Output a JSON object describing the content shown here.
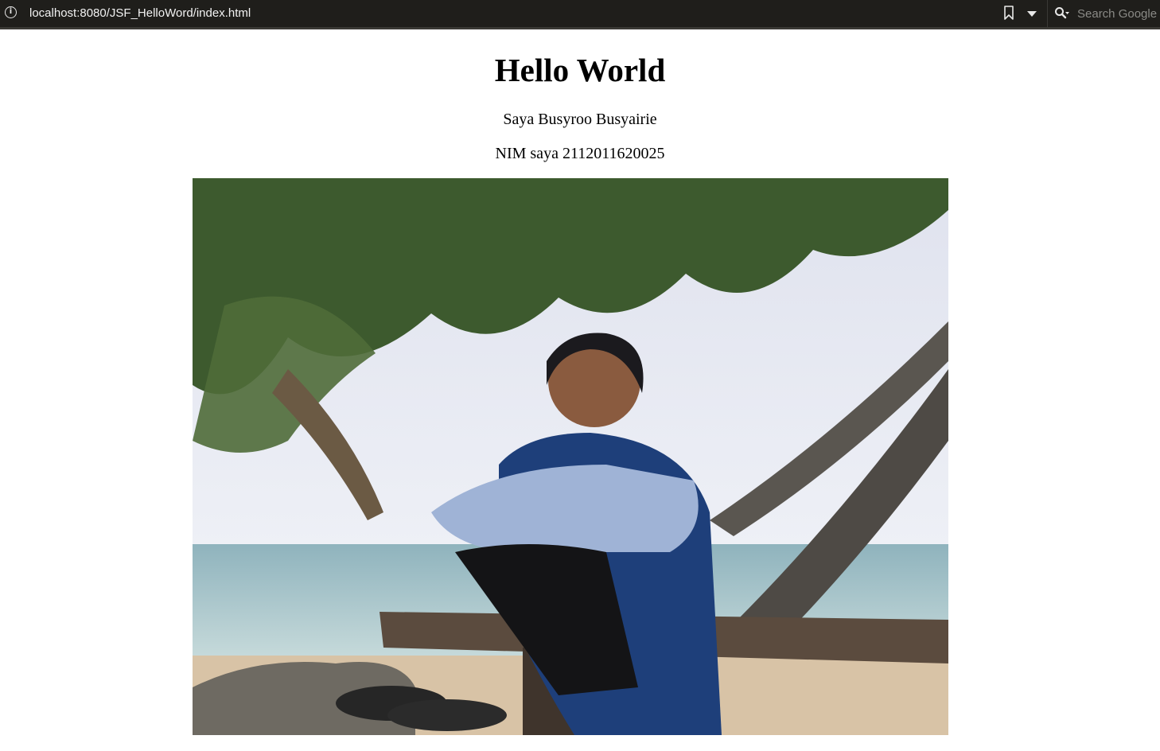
{
  "browser": {
    "url": "localhost:8080/JSF_HelloWord/index.html",
    "search_placeholder": "Search Google"
  },
  "page": {
    "heading": "Hello World",
    "intro": "Saya Busyroo Busyairie",
    "nim": "NIM saya 2112011620025"
  },
  "icons": {
    "info": "info-icon",
    "bookmark": "bookmark-icon",
    "dropdown": "chevron-down-icon",
    "search": "search-icon"
  },
  "colors": {
    "toolbar_bg": "#1f1e1b",
    "page_bg": "#ffffff",
    "text": "#000000"
  }
}
